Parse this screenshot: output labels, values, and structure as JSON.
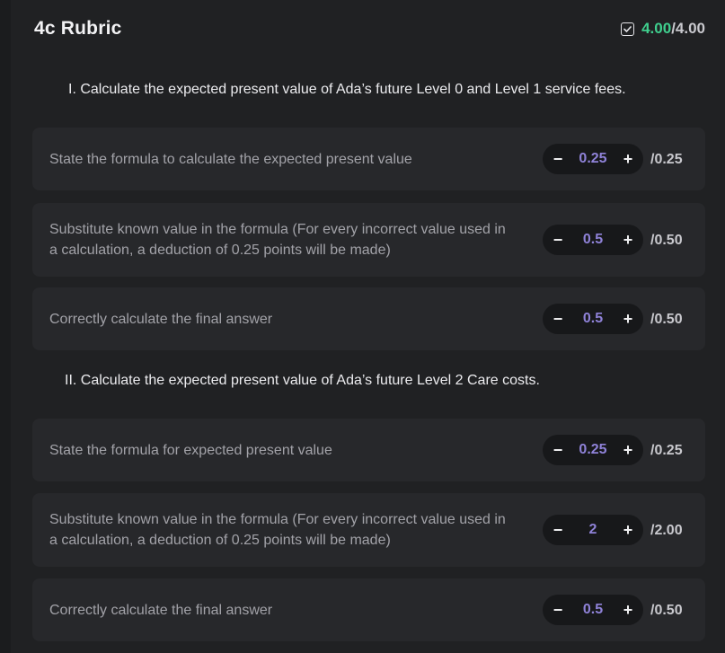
{
  "header": {
    "title": "4c Rubric",
    "score_earned": "4.00",
    "score_total": "/4.00",
    "icon": "checkbox-checked-icon"
  },
  "sections": [
    {
      "title": "I. Calculate the expected present value of Ada’s future Level 0 and Level 1 service fees.",
      "criteria": [
        {
          "label": "State the formula to calculate the expected present value",
          "value": "0.25",
          "max": "/0.25"
        },
        {
          "label": "Substitute known value in the formula (For every incorrect value used in a calculation, a deduction of 0.25 points will be made)",
          "value": "0.5",
          "max": "/0.50"
        },
        {
          "label": "Correctly calculate the final answer",
          "value": "0.5",
          "max": "/0.50"
        }
      ]
    },
    {
      "title": "II. Calculate the expected present value of Ada’s future Level 2 Care costs.",
      "criteria": [
        {
          "label": "State the formula for expected present value",
          "value": "0.25",
          "max": "/0.25"
        },
        {
          "label": "Substitute known value in the formula (For every incorrect value used in a calculation, a deduction of 0.25 points will be made)",
          "value": "2",
          "max": "/2.00"
        },
        {
          "label": "Correctly calculate the final answer",
          "value": "0.5",
          "max": "/0.50"
        }
      ]
    }
  ],
  "stepper": {
    "minus_label": "−",
    "plus_label": "+"
  },
  "colors": {
    "earned": "#3fcf8e",
    "value": "#8f82d8",
    "row_bg": "#27282b",
    "panel_bg": "#202123"
  }
}
